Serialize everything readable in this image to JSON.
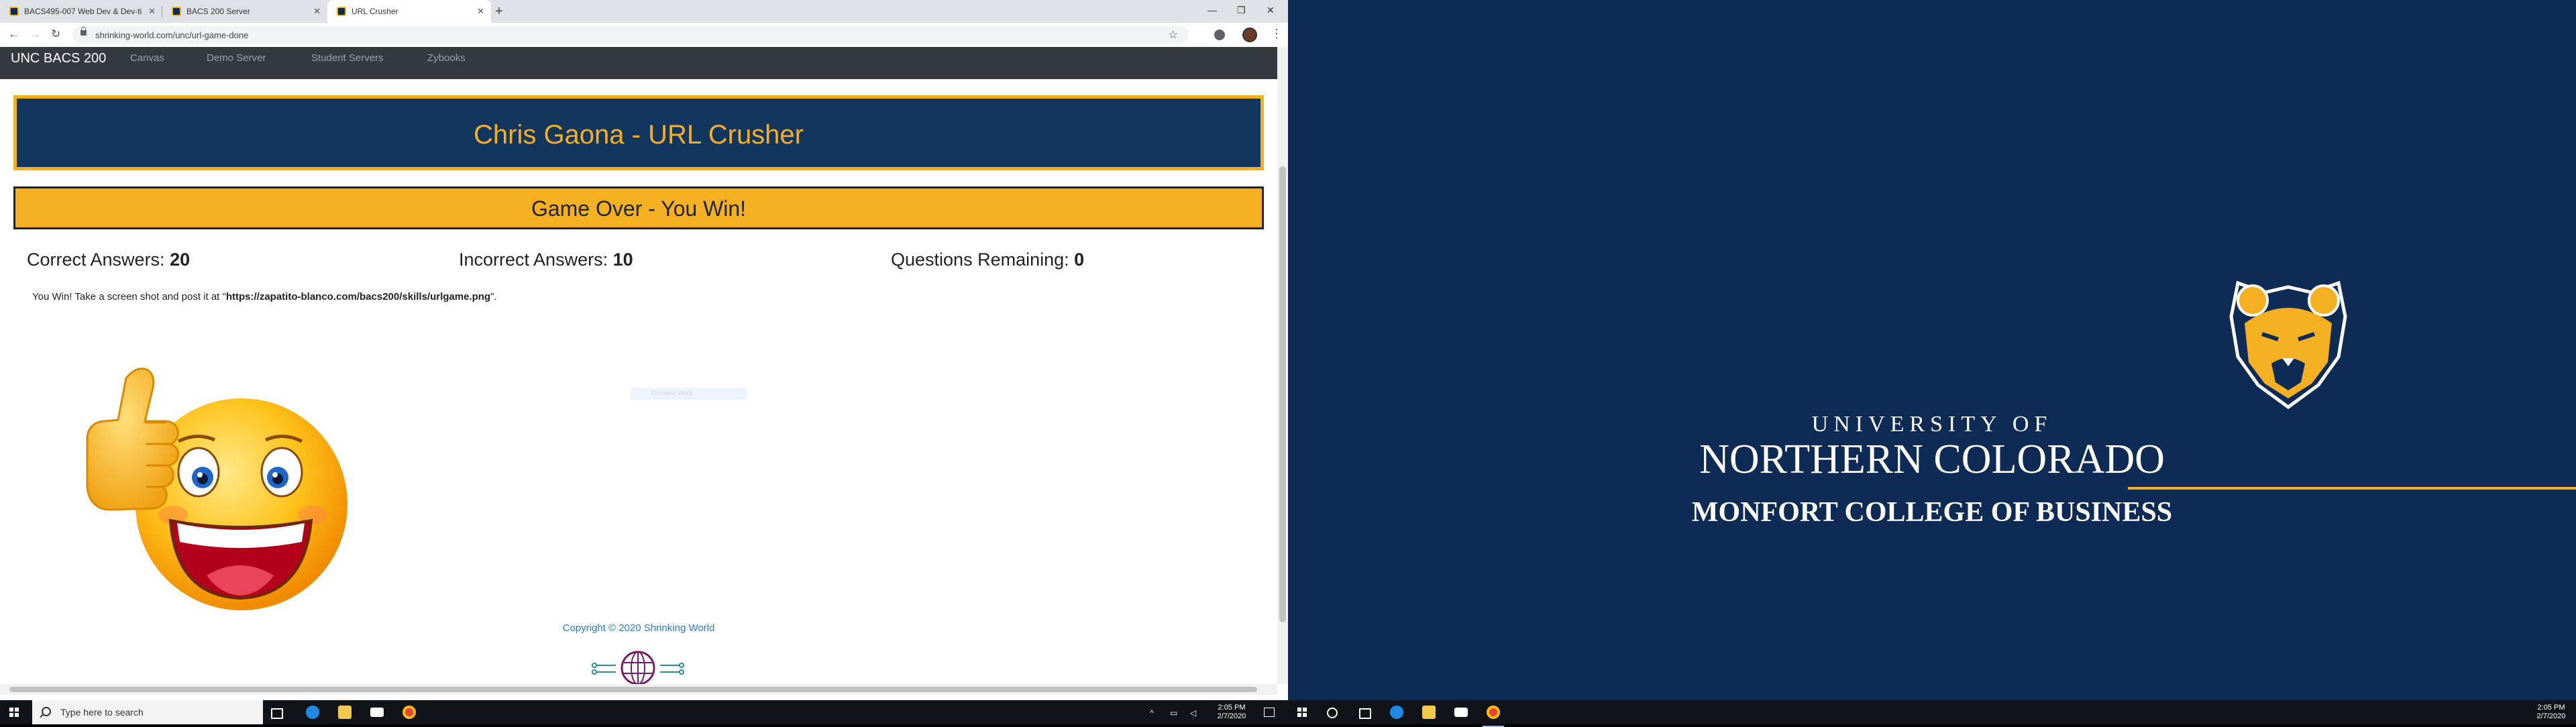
{
  "browser": {
    "tabs": [
      {
        "label": "BACS495-007 Web Dev & Dev-ti"
      },
      {
        "label": "BACS 200 Server"
      },
      {
        "label": "URL Crusher"
      }
    ],
    "url": "shrinking-world.com/unc/url-game-done"
  },
  "site": {
    "brand": "UNC BACS 200",
    "nav": [
      "Canvas",
      "Demo Server",
      "Student Servers",
      "Zybooks"
    ]
  },
  "game": {
    "title": "Chris Gaona - URL Crusher",
    "result": "Game Over - You Win!",
    "stats": {
      "correct_label": "Correct Answers:",
      "correct_value": "20",
      "incorrect_label": "Incorrect Answers:",
      "incorrect_value": "10",
      "remaining_label": "Questions Remaining:",
      "remaining_value": "0"
    },
    "message_prefix": "You Win! Take a screen shot and post it at \"",
    "message_link": "https://zapatito-blanco.com/bacs200/skills/urlgame.png",
    "message_suffix": "\".",
    "faint_text": "Shrinking World"
  },
  "footer": {
    "copyright": "Copyright © 2020 Shrinking World"
  },
  "taskbar": {
    "search_placeholder": "Type here to search",
    "time": "2:05 PM",
    "date": "2/7/2020"
  },
  "wallpaper": {
    "line1": "UNIVERSITY OF",
    "line2": "NORTHERN COLORADO",
    "line3": "MONFORT COLLEGE OF BUSINESS"
  },
  "colors": {
    "navy": "#13365f",
    "gold": "#f5b021",
    "wallpaper_bg": "#0d2b55",
    "navbar": "#343a40"
  }
}
